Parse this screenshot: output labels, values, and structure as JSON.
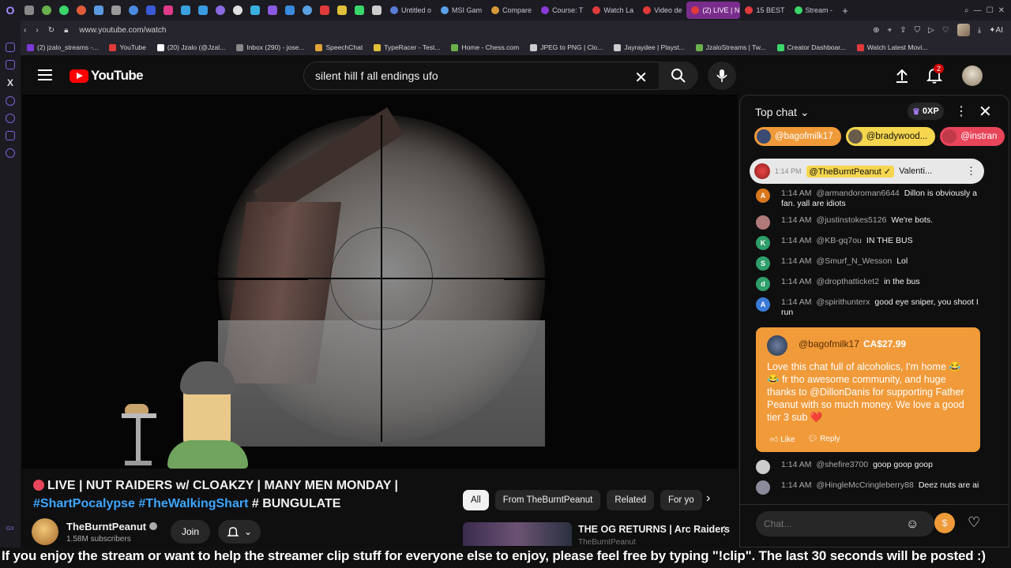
{
  "browser": {
    "tabs": [
      {
        "label": "Untitled o",
        "color": "#5a7bd6"
      },
      {
        "label": "MSI Gam",
        "color": "#5aa0e6"
      },
      {
        "label": "Compare",
        "color": "#d69a3a"
      },
      {
        "label": "Course: T",
        "color": "#8a3ad6"
      },
      {
        "label": "Watch La",
        "color": "#e03a3a"
      },
      {
        "label": "Video de",
        "color": "#e03a3a"
      },
      {
        "label": "(2) LIVE | N",
        "color": "#e03a3a"
      },
      {
        "label": "15 BEST",
        "color": "#e03a3a"
      },
      {
        "label": "Stream -",
        "color": "#3ad66a"
      }
    ],
    "url": "www.youtube.com/watch",
    "bookmarks": [
      {
        "label": "(2) jzalo_streams -...",
        "color": "#7a3ad6"
      },
      {
        "label": "YouTube",
        "color": "#e03a3a"
      },
      {
        "label": "(20) Jzalo (@Jzal...",
        "color": "#ffffff"
      },
      {
        "label": "Inbox (290) - jose...",
        "color": "#888888"
      },
      {
        "label": "SpeechChat",
        "color": "#e0a43a"
      },
      {
        "label": "TypeRacer - Test...",
        "color": "#e0c03a"
      },
      {
        "label": "Home - Chess.com",
        "color": "#6ab04c"
      },
      {
        "label": "JPEG to PNG | Clo...",
        "color": "#cccccc"
      },
      {
        "label": "Jayraydee | Playst...",
        "color": "#cccccc"
      },
      {
        "label": "JzaloStreams | Tw...",
        "color": "#6ab04c"
      },
      {
        "label": "Creator Dashboar...",
        "color": "#3ad66a"
      },
      {
        "label": "Watch Latest Movi...",
        "color": "#e03a3a"
      }
    ],
    "sidebar_bottom": "GX"
  },
  "masthead": {
    "logo": "YouTube",
    "search_value": "silent hill f all endings ufo",
    "notification_count": "2"
  },
  "video": {
    "title_prefix": "LIVE | NUT RAIDERS w/ CLOAKZY | MANY MEN MONDAY |",
    "hashtag1": "#ShartPocalypse",
    "hashtag2": "#TheWalkingShart",
    "title_suffix": "# BUNGULATE",
    "channel": "TheBurntPeanut",
    "subscribers": "1.58M subscribers",
    "join_label": "Join"
  },
  "chips": [
    "All",
    "From TheBurntPeanut",
    "Related",
    "For yo"
  ],
  "recommendation": {
    "title": "THE OG RETURNS | Arc Raiders",
    "channel": "TheBurntPeanut"
  },
  "chat": {
    "header": "Top chat",
    "xp": "0XP",
    "tickers": [
      {
        "user": "@bagofmilk17",
        "color": "#f09a3a"
      },
      {
        "user": "@bradywood...",
        "color": "#f5d64e"
      },
      {
        "user": "@instran",
        "color": "#e8455a"
      }
    ],
    "pinned": {
      "time": "1:14 PM",
      "user": "@TheBurntPeanut ✓",
      "text": "Valenti..."
    },
    "messages": [
      {
        "avatar": "A",
        "color": "#d9771c",
        "time": "1:14 AM",
        "user": "@armandoroman6644",
        "text": "Dillon is obviously a fan. yall are idiots"
      },
      {
        "avatar": "",
        "color": "#b07a7a",
        "time": "1:14 AM",
        "user": "@justinstokes5126",
        "text": "We're bots."
      },
      {
        "avatar": "K",
        "color": "#2e9e6a",
        "time": "1:14 AM",
        "user": "@KB-gq7ou",
        "text": "IN THE BUS"
      },
      {
        "avatar": "S",
        "color": "#2e9e6a",
        "time": "1:14 AM",
        "user": "@Smurf_N_Wesson",
        "text": "Lol"
      },
      {
        "avatar": "d",
        "color": "#2e9e6a",
        "time": "1:14 AM",
        "user": "@dropthatticket2",
        "text": "in the bus"
      },
      {
        "avatar": "A",
        "color": "#3a7bd6",
        "time": "1:14 AM",
        "user": "@spirithunterx",
        "text": "good eye sniper, you shoot I run"
      }
    ],
    "superchat": {
      "user": "@bagofmilk17",
      "amount": "CA$27.99",
      "text": "Love this chat full of alcoholics, I'm home 😂😂 fr tho awesome community, and huge thanks to @DillonDanis for supporting Father Peanut with so much money. We love a good tier 3 sub ❤️",
      "like": "Like",
      "reply": "Reply"
    },
    "messages2": [
      {
        "avatar": "",
        "color": "#cccccc",
        "time": "1:14 AM",
        "user": "@shefire3700",
        "text": "goop goop goop"
      },
      {
        "avatar": "",
        "color": "#8a8a9a",
        "time": "1:14 AM",
        "user": "@HingleMcCringleberry88",
        "text": "Deez nuts are ai"
      }
    ],
    "input_placeholder": "Chat..."
  },
  "overlay_text": "If you enjoy the stream or want to help the streamer clip stuff for everyone else to enjoy, please feel free by typing \"!clip\". The last 30 seconds will be posted :)"
}
